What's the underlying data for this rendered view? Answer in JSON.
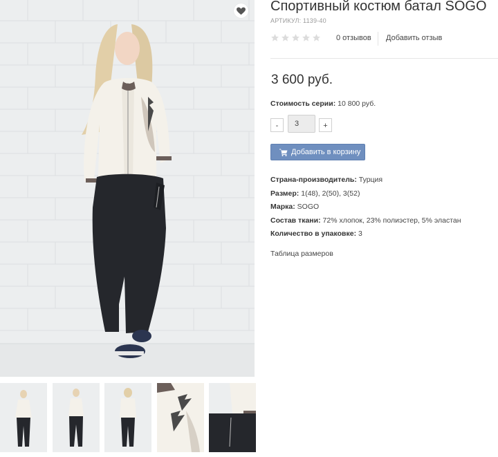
{
  "product": {
    "title": "Спортивный костюм батал SOGO",
    "sku": "АРТИКУЛ: 1139-40",
    "rating_stars": 0,
    "rating_max": 5,
    "reviews_count_label": "0 отзывов",
    "add_review_label": "Добавить отзыв",
    "price": "3 600 руб.",
    "series_label": "Стоимость серии:",
    "series_value": "10 800 руб.",
    "quantity": "3",
    "qty_minus": "-",
    "qty_plus": "+",
    "add_to_cart_label": "Добавить в корзину",
    "size_table_label": "Таблица размеров"
  },
  "properties": [
    {
      "label": "Страна-производитель:",
      "value": "Турция"
    },
    {
      "label": "Размер:",
      "value": "1(48), 2(50), 3(52)"
    },
    {
      "label": "Марка:",
      "value": "SOGO"
    },
    {
      "label": "Состав ткани:",
      "value": "72% хлопок, 23% полиэстер, 5% эластан"
    },
    {
      "label": "Количество в упаковке:",
      "value": "3"
    }
  ],
  "gallery": {
    "thumbnails": [
      "front-full",
      "front-full-2",
      "back-full",
      "jacket-detail",
      "pocket-detail"
    ]
  },
  "icons": {
    "wishlist": "heart-icon",
    "cart": "cart-icon",
    "star": "star-icon"
  },
  "colors": {
    "accent_button": "#6f8fbf",
    "star_empty": "#dcdcdc",
    "divider": "#e6e6e6"
  }
}
